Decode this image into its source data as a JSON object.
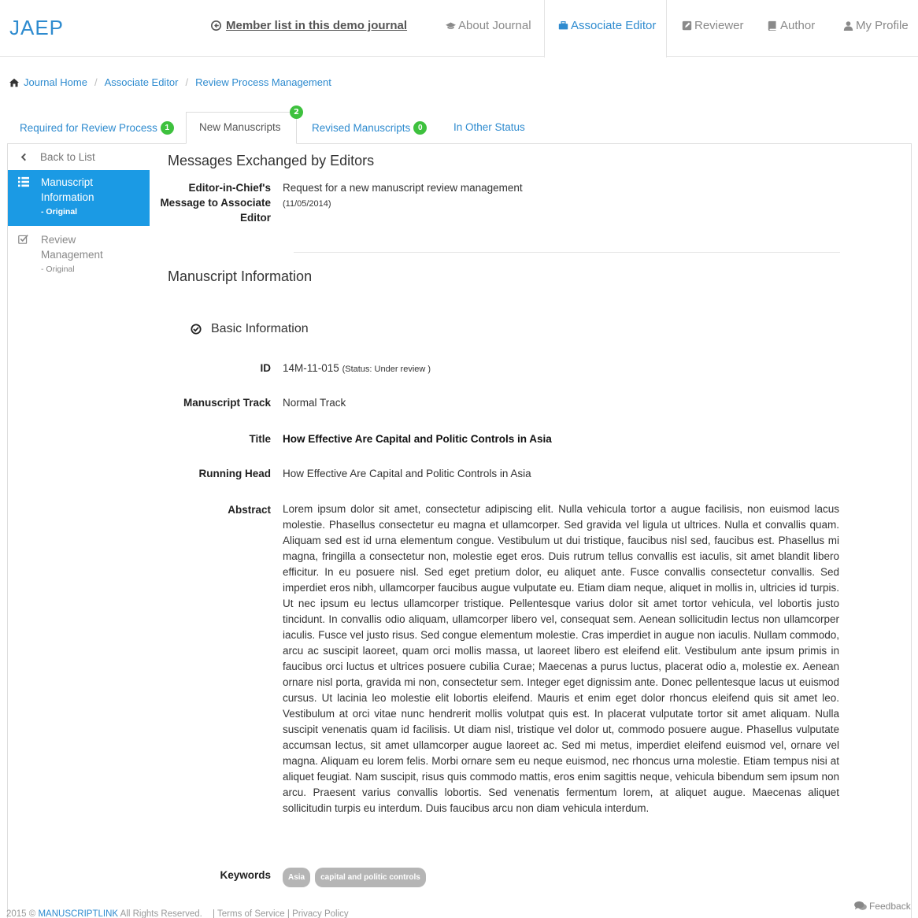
{
  "app": {
    "logo": "JAEP"
  },
  "nav": {
    "member_list": "Member list in this demo journal",
    "about": "About Journal",
    "associate_editor": "Associate Editor",
    "reviewer": "Reviewer",
    "author": "Author",
    "my_profile": "My Profile"
  },
  "breadcrumb": [
    "Journal Home",
    "Associate Editor",
    "Review Process Management"
  ],
  "tabs": [
    {
      "label": "Required for Review Process",
      "badge": "1"
    },
    {
      "label": "New Manuscripts",
      "badge": "2"
    },
    {
      "label": "Revised Manuscripts",
      "badge": "0"
    },
    {
      "label": "In Other Status",
      "badge": ""
    }
  ],
  "sidebar": {
    "back": "Back to List",
    "items": [
      {
        "label": "Manuscript Information",
        "sub": "- Original"
      },
      {
        "label": "Review Management",
        "sub": "- Original"
      }
    ]
  },
  "messages": {
    "heading": "Messages Exchanged by Editors",
    "label": "Editor-in-Chief's Message to Associate Editor",
    "text": "Request for a new manuscript review management",
    "date": "(11/05/2014)"
  },
  "manuscript": {
    "heading": "Manuscript Information",
    "basic_heading": "Basic Information",
    "id_label": "ID",
    "id_value": "14M-11-015",
    "status": "(Status: Under review )",
    "track_label": "Manuscript Track",
    "track_value": "Normal Track",
    "title_label": "Title",
    "title_value": "How Effective Are Capital and Politic Controls in Asia",
    "running_label": "Running Head",
    "running_value": "How Effective Are Capital and Politic Controls in Asia",
    "abstract_label": "Abstract",
    "abstract_value": "Lorem ipsum dolor sit amet, consectetur adipiscing elit. Nulla vehicula tortor a augue facilisis, non euismod lacus molestie. Phasellus consectetur eu magna et ullamcorper. Sed gravida vel ligula ut ultrices. Nulla et convallis quam. Aliquam sed est id urna elementum congue. Vestibulum ut dui tristique, faucibus nisl sed, faucibus est. Phasellus mi magna, fringilla a consectetur non, molestie eget eros. Duis rutrum tellus convallis est iaculis, sit amet blandit libero efficitur. In eu posuere nisl. Sed eget pretium dolor, eu aliquet ante. Fusce convallis consectetur convallis. Sed imperdiet eros nibh, ullamcorper faucibus augue vulputate eu. Etiam diam neque, aliquet in mollis in, ultricies id turpis. Ut nec ipsum eu lectus ullamcorper tristique. Pellentesque varius dolor sit amet tortor vehicula, vel lobortis justo tincidunt. In convallis odio aliquam, ullamcorper libero vel, consequat sem. Aenean sollicitudin lectus non ullamcorper iaculis. Fusce vel justo risus. Sed congue elementum molestie. Cras imperdiet in augue non iaculis. Nullam commodo, arcu ac suscipit laoreet, quam orci mollis massa, ut laoreet libero est eleifend elit. Vestibulum ante ipsum primis in faucibus orci luctus et ultrices posuere cubilia Curae; Maecenas a purus luctus, placerat odio a, molestie ex. Aenean ornare nisl porta, gravida mi non, consectetur sem. Integer eget dignissim ante. Donec pellentesque lacus ut euismod cursus. Ut lacinia leo molestie elit lobortis eleifend. Mauris et enim eget dolor rhoncus eleifend quis sit amet leo. Vestibulum at orci vitae nunc hendrerit mollis volutpat quis est. In placerat vulputate tortor sit amet aliquam. Nulla suscipit venenatis quam id facilisis. Ut diam nisl, tristique vel dolor ut, commodo posuere augue. Phasellus vulputate accumsan lectus, sit amet ullamcorper augue laoreet ac. Sed mi metus, imperdiet eleifend euismod vel, ornare vel magna. Aliquam eu lorem felis. Morbi ornare sem eu neque euismod, nec rhoncus urna molestie. Etiam tempus nisi at aliquet feugiat. Nam suscipit, risus quis commodo mattis, eros enim sagittis neque, vehicula bibendum sem ipsum non arcu. Praesent varius convallis lobortis. Sed venenatis fermentum lorem, at aliquet augue. Maecenas aliquet sollicitudin turpis eu interdum. Duis faucibus arcu non diam vehicula interdum.",
    "keywords_label": "Keywords",
    "keywords": [
      "Asia",
      "capital and politic controls"
    ]
  },
  "footer": {
    "copyright_prefix": "2015 ©",
    "brand": "MANUSCRIPTLINK",
    "rights": "All Rights Reserved.",
    "terms": "Terms of Service",
    "privacy": "Privacy Policy",
    "feedback": "Feedback"
  },
  "colors": {
    "accent": "#2e8bcf",
    "sidebar_active": "#1b9ae4",
    "badge": "#3ec13e",
    "keyword": "#b5b5b5"
  }
}
